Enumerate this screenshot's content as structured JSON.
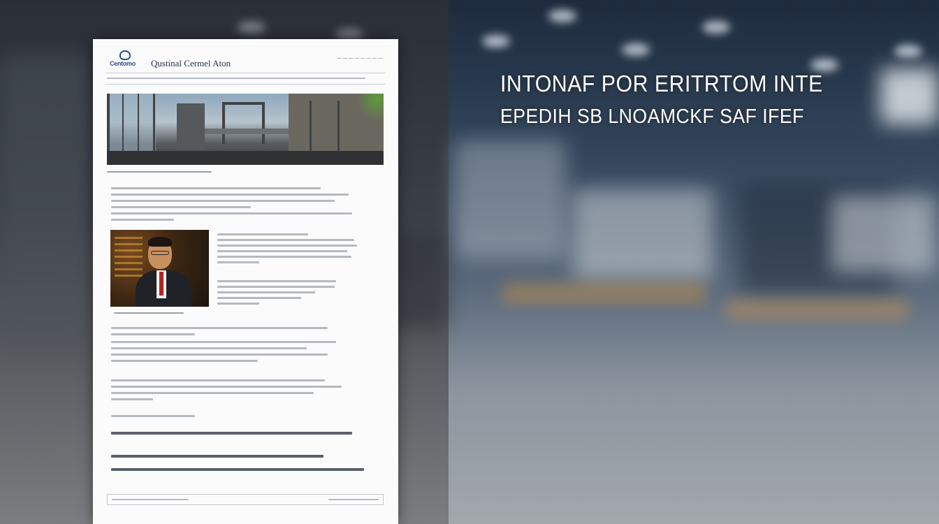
{
  "document": {
    "logo_text": "Centomo",
    "title": "Qustinal Cermel Aton",
    "meta": "— — — — — — — —"
  },
  "overlay": {
    "headline_line1": "INTONAF POR ERITRTOM INTE",
    "headline_line2": "EPEDIH SB LNOAMCKF SAF IFEF"
  },
  "colors": {
    "accent": "#2d4f8e",
    "sheet": "#fbfbfb",
    "headline": "#ffffff"
  }
}
